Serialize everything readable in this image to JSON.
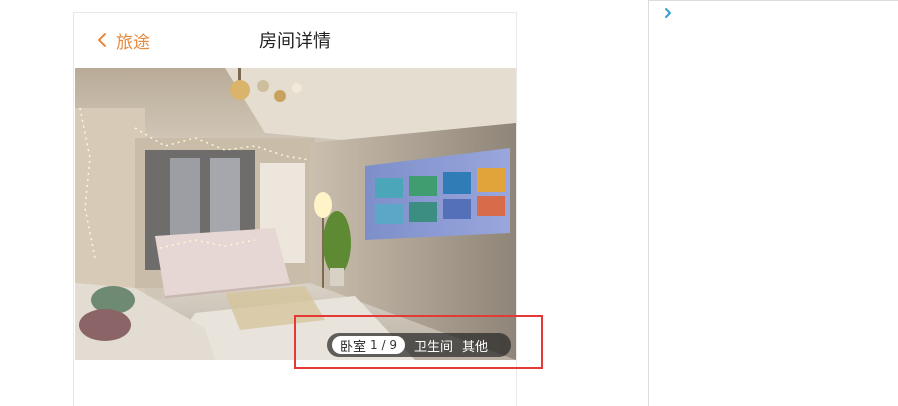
{
  "header": {
    "back_label": "旅途",
    "title": "房间详情"
  },
  "gallery": {
    "tabs": [
      {
        "label": "卧室",
        "active": true
      },
      {
        "label": "卫生间",
        "active": false
      },
      {
        "label": "其他",
        "active": false
      }
    ],
    "counter": "1 / 9"
  },
  "colors": {
    "accent": "#e8893b",
    "highlight_box": "#e53935",
    "chevron": "#3b9bd3"
  },
  "icons": {
    "back": "chevron-left-icon",
    "expand": "chevron-right-icon"
  }
}
